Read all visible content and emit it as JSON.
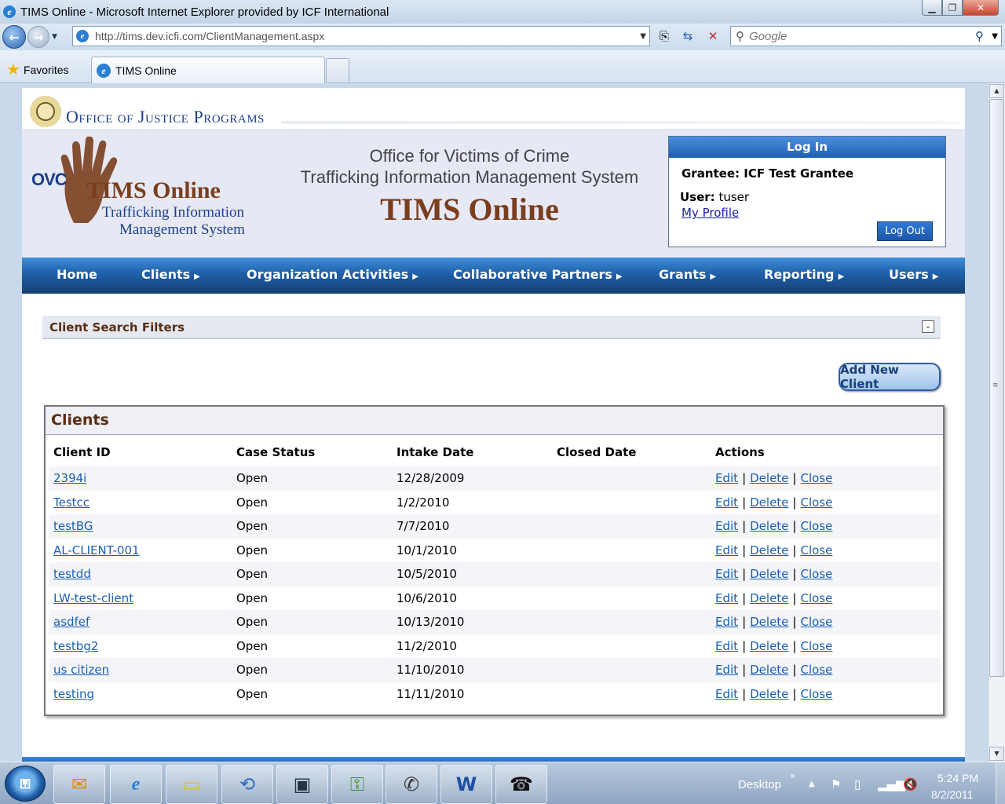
{
  "window": {
    "title": "TIMS Online - Microsoft Internet Explorer provided by ICF International"
  },
  "browser": {
    "url": "http://tims.dev.icfi.com/ClientManagement.aspx",
    "search_placeholder": "Google",
    "favorites_label": "Favorites",
    "tab_label": "TIMS Online"
  },
  "site": {
    "agency": "Office of Justice Programs",
    "logo": {
      "ovc": "OVC",
      "tims": "TIMS Online",
      "sub1": "Trafficking Information",
      "sub2": "Management System"
    },
    "banner": {
      "line1": "Office for Victims of Crime",
      "line2": "Trafficking Information Management System",
      "line3": "TIMS Online"
    }
  },
  "login": {
    "header": "Log In",
    "grantee": "Grantee: ICF Test Grantee",
    "user_label": "User:",
    "user_value": "tuser",
    "profile_link": "My Profile",
    "logout_button": "Log Out"
  },
  "menu": {
    "items": [
      {
        "label": "Home"
      },
      {
        "label": "Clients"
      },
      {
        "label": "Organization Activities"
      },
      {
        "label": "Collaborative Partners"
      },
      {
        "label": "Grants"
      },
      {
        "label": "Reporting"
      },
      {
        "label": "Users"
      }
    ]
  },
  "filters": {
    "label": "Client Search Filters"
  },
  "add_button": "Add New Client",
  "clients": {
    "title": "Clients",
    "columns": [
      "Client ID",
      "Case Status",
      "Intake Date",
      "Closed Date",
      "Actions"
    ],
    "actions": {
      "edit": "Edit",
      "delete": "Delete",
      "close": "Close",
      "separator": "|"
    },
    "rows": [
      {
        "id": "2394i",
        "status": "Open",
        "intake": "12/28/2009",
        "closed": ""
      },
      {
        "id": "Testcc",
        "status": "Open",
        "intake": "1/2/2010",
        "closed": ""
      },
      {
        "id": "testBG",
        "status": "Open",
        "intake": "7/7/2010",
        "closed": ""
      },
      {
        "id": "AL-CLIENT-001",
        "status": "Open",
        "intake": "10/1/2010",
        "closed": ""
      },
      {
        "id": "testdd",
        "status": "Open",
        "intake": "10/5/2010",
        "closed": ""
      },
      {
        "id": "LW-test-client",
        "status": "Open",
        "intake": "10/6/2010",
        "closed": ""
      },
      {
        "id": "asdfef",
        "status": "Open",
        "intake": "10/13/2010",
        "closed": ""
      },
      {
        "id": "testbg2",
        "status": "Open",
        "intake": "11/2/2010",
        "closed": ""
      },
      {
        "id": "us citizen",
        "status": "Open",
        "intake": "11/10/2010",
        "closed": ""
      },
      {
        "id": "testing",
        "status": "Open",
        "intake": "11/11/2010",
        "closed": ""
      }
    ]
  },
  "taskbar": {
    "desktop_label": "Desktop",
    "time": "5:24 PM",
    "date": "8/2/2011"
  }
}
